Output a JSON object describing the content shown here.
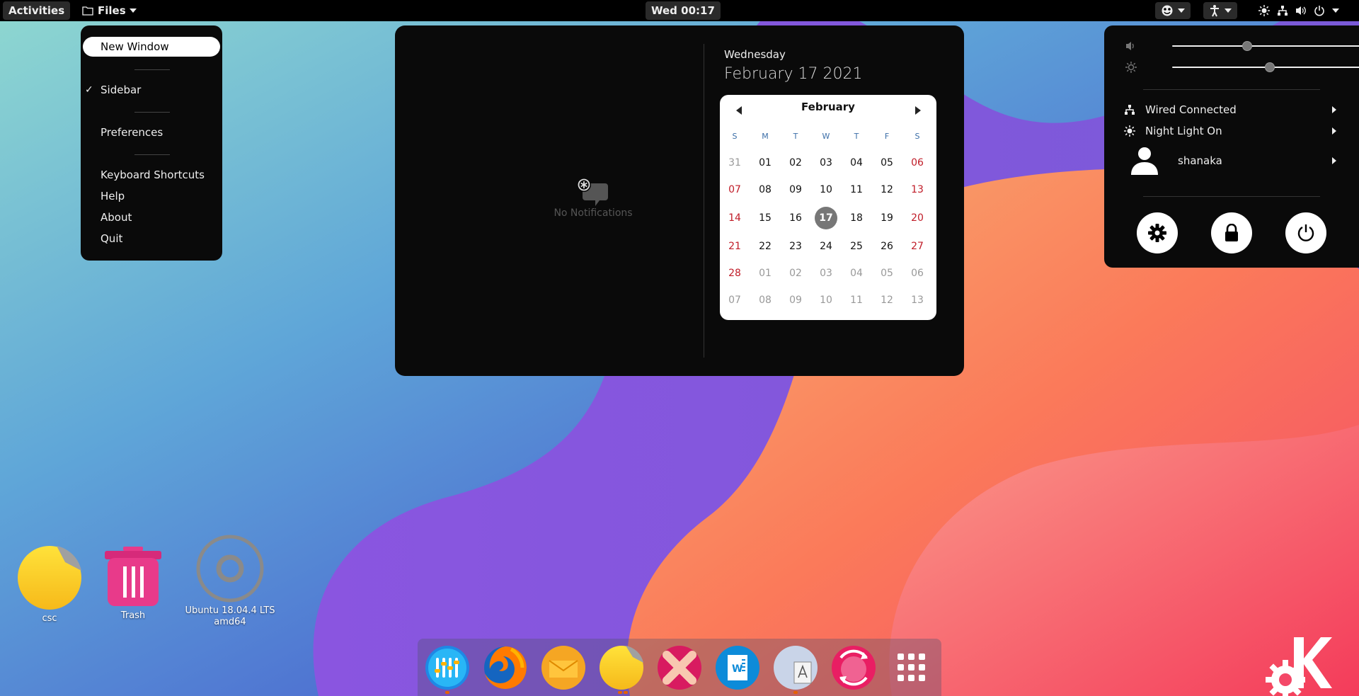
{
  "topbar": {
    "activities_label": "Activities",
    "app_name": "Files",
    "clock": "Wed 00:17"
  },
  "app_menu": {
    "items": [
      {
        "label": "New Window",
        "highlighted": true
      },
      {
        "label": "Sidebar",
        "checked": true
      },
      {
        "label": "Preferences"
      },
      {
        "label": "Keyboard Shortcuts"
      },
      {
        "label": "Help"
      },
      {
        "label": "About"
      },
      {
        "label": "Quit"
      }
    ]
  },
  "notifications": {
    "empty_text": "No Notifications"
  },
  "calendar": {
    "weekday": "Wednesday",
    "full_date": "February 17 2021",
    "month": "February",
    "day_headers": [
      "S",
      "M",
      "T",
      "W",
      "T",
      "F",
      "S"
    ],
    "weeks": [
      [
        "31",
        "01",
        "02",
        "03",
        "04",
        "05",
        "06"
      ],
      [
        "07",
        "08",
        "09",
        "10",
        "11",
        "12",
        "13"
      ],
      [
        "14",
        "15",
        "16",
        "17",
        "18",
        "19",
        "20"
      ],
      [
        "21",
        "22",
        "23",
        "24",
        "25",
        "26",
        "27"
      ],
      [
        "28",
        "01",
        "02",
        "03",
        "04",
        "05",
        "06"
      ],
      [
        "07",
        "08",
        "09",
        "10",
        "11",
        "12",
        "13"
      ]
    ],
    "today": "17"
  },
  "system_menu": {
    "volume_level": 0.4,
    "brightness_level": 0.52,
    "network_label": "Wired Connected",
    "night_light_label": "Night Light On",
    "user_name": "shanaka"
  },
  "desktop": {
    "icons": [
      {
        "label": "csc"
      },
      {
        "label": "Trash"
      },
      {
        "label": "Ubuntu 18.04.4 LTS amd64"
      }
    ]
  },
  "colors": {
    "accent": "#e66100",
    "weekend": "#c01c28",
    "header": "#3b6ea8"
  }
}
